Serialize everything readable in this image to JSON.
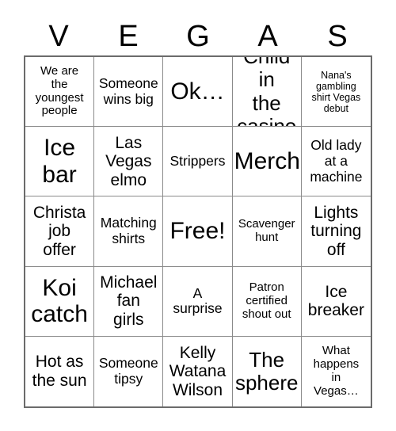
{
  "card": {
    "title_letters": [
      "V",
      "E",
      "G",
      "A",
      "S"
    ],
    "columns": 5,
    "rows": 5,
    "free_space_label": "Free!",
    "colors": {
      "background": "#ffffff",
      "text": "#000000",
      "outer_border": "#6b6b6b",
      "inner_border": "#8a8a8a"
    }
  },
  "cells": [
    {
      "text": "We are\nthe\nyoungest\npeople",
      "size": "sm"
    },
    {
      "text": "Someone\nwins big",
      "size": "md"
    },
    {
      "text": "Ok…",
      "size": "xxl"
    },
    {
      "text": "Child in\nthe\ncasino",
      "size": "xl"
    },
    {
      "text": "Nana's\ngambling\nshirt Vegas\ndebut",
      "size": "xs"
    },
    {
      "text": "Ice\nbar",
      "size": "xxl"
    },
    {
      "text": "Las\nVegas\nelmo",
      "size": "lg"
    },
    {
      "text": "Strippers",
      "size": "md"
    },
    {
      "text": "Merch",
      "size": "xxl"
    },
    {
      "text": "Old lady\nat a\nmachine",
      "size": "md"
    },
    {
      "text": "Christa\njob\noffer",
      "size": "lg"
    },
    {
      "text": "Matching\nshirts",
      "size": "md"
    },
    {
      "text": "Free!",
      "size": "xxl"
    },
    {
      "text": "Scavenger\nhunt",
      "size": "sm"
    },
    {
      "text": "Lights\nturning\noff",
      "size": "lg"
    },
    {
      "text": "Koi\ncatch",
      "size": "xxl"
    },
    {
      "text": "Michael\nfan\ngirls",
      "size": "lg"
    },
    {
      "text": "A\nsurprise",
      "size": "md"
    },
    {
      "text": "Patron\ncertified\nshout out",
      "size": "sm"
    },
    {
      "text": "Ice\nbreaker",
      "size": "lg"
    },
    {
      "text": "Hot as\nthe sun",
      "size": "lg"
    },
    {
      "text": "Someone\ntipsy",
      "size": "md"
    },
    {
      "text": "Kelly\nWatana\nWilson",
      "size": "lg"
    },
    {
      "text": "The\nsphere",
      "size": "xl"
    },
    {
      "text": "What\nhappens\nin\nVegas…",
      "size": "sm"
    }
  ]
}
